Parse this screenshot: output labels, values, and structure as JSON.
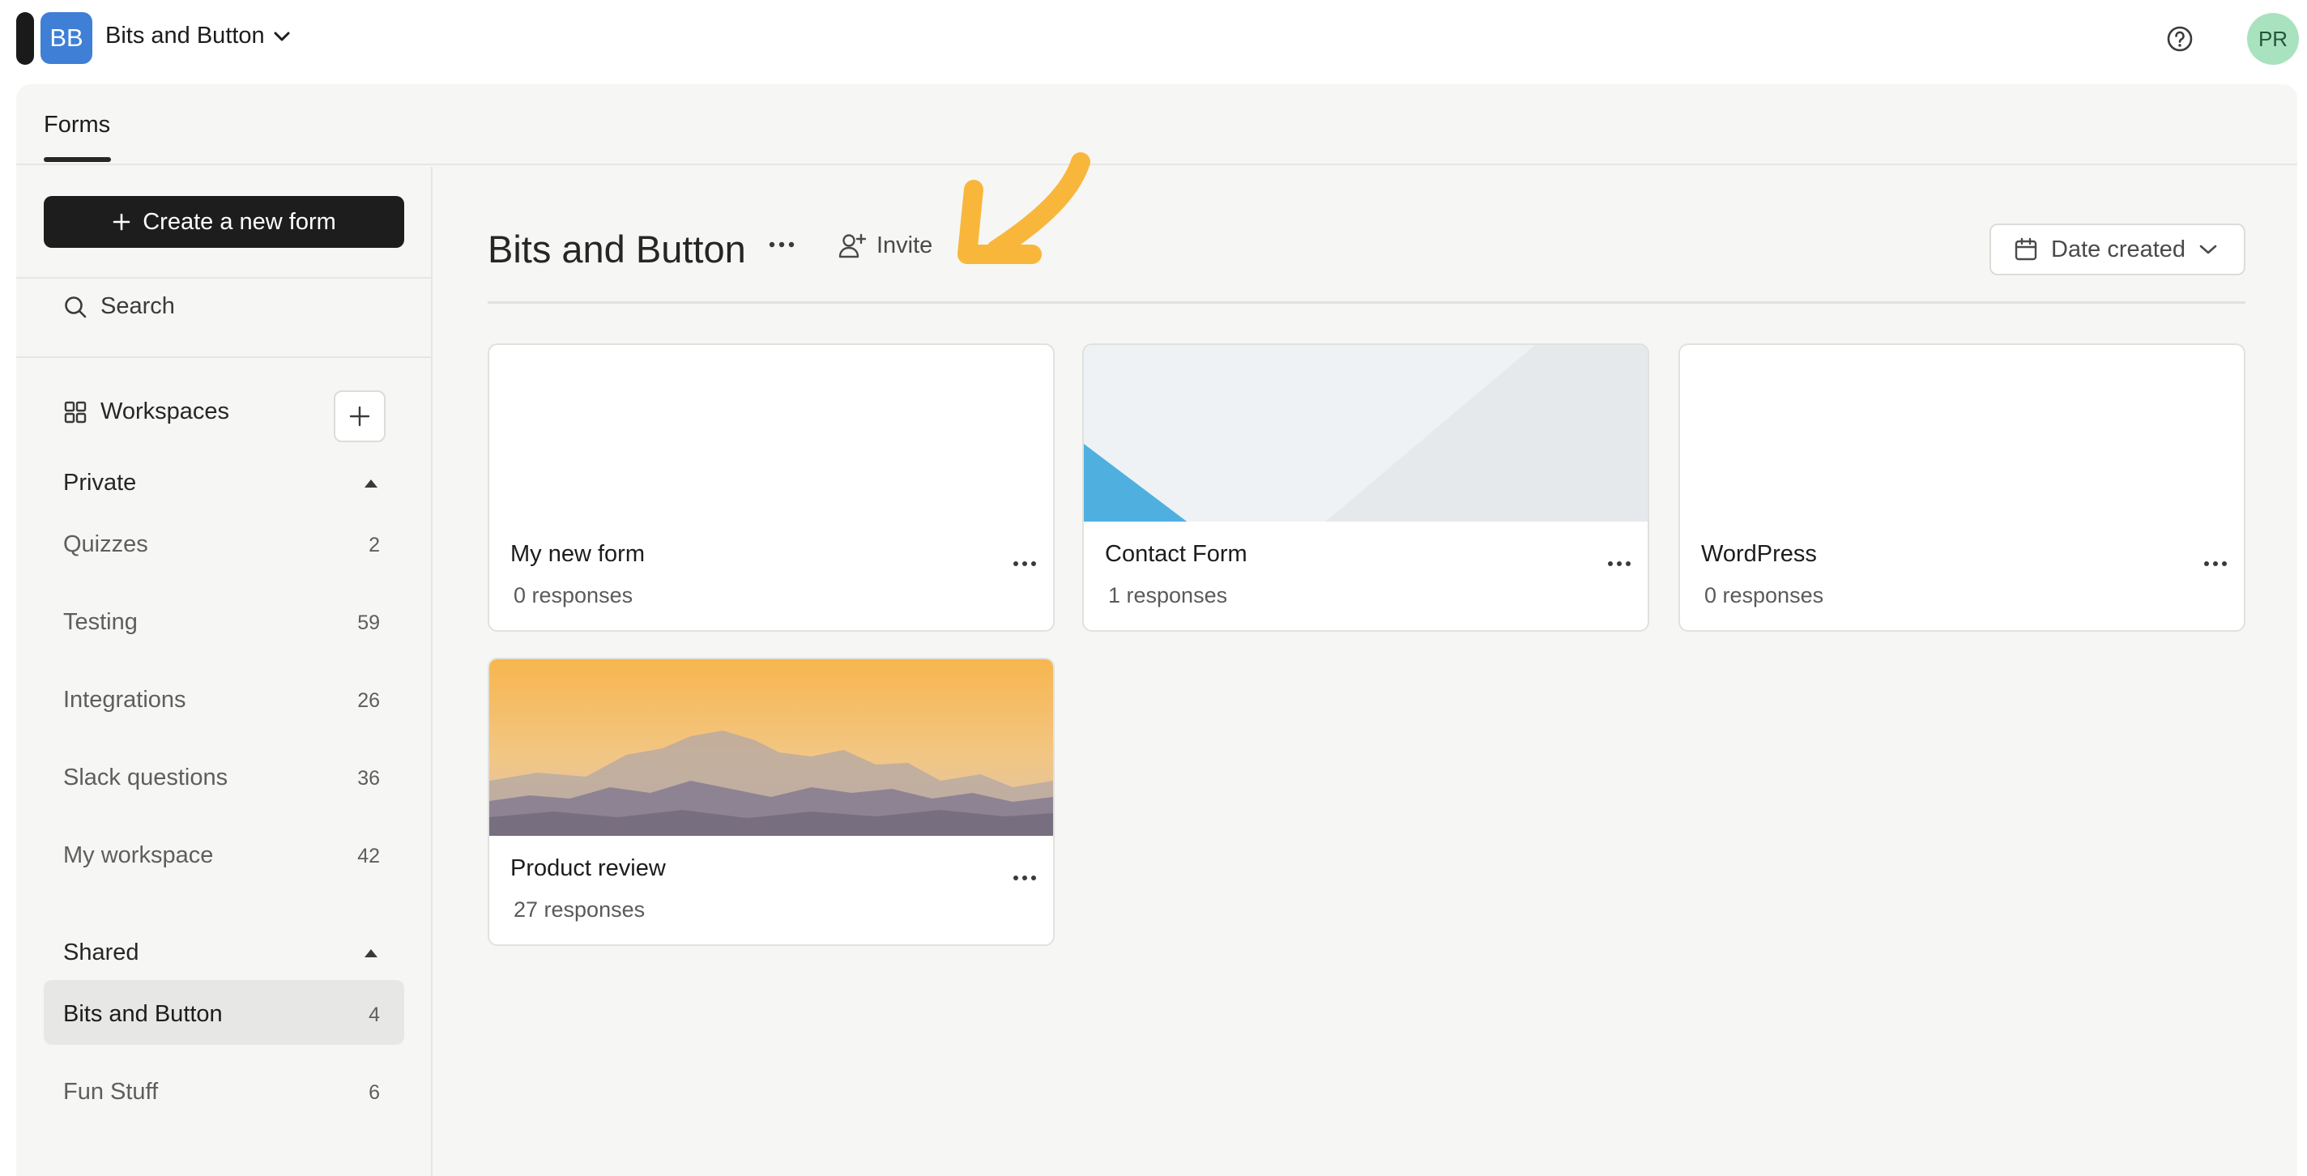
{
  "topbar": {
    "org_initials": "BB",
    "org_name": "Bits and Button",
    "help_icon": "question-circle-icon",
    "user_initials": "PR",
    "colors": {
      "org_badge": "#3f7fd6",
      "avatar_bg": "#a9e2bf"
    }
  },
  "tabs": [
    {
      "label": "Forms",
      "active": true
    }
  ],
  "sidebar": {
    "create_label": "Create a new form",
    "search_label": "Search",
    "workspaces_label": "Workspaces",
    "private_label": "Private",
    "shared_label": "Shared",
    "private_items": [
      {
        "name": "Quizzes",
        "count": "2"
      },
      {
        "name": "Testing",
        "count": "59"
      },
      {
        "name": "Integrations",
        "count": "26"
      },
      {
        "name": "Slack questions",
        "count": "36"
      },
      {
        "name": "My workspace",
        "count": "42"
      }
    ],
    "shared_items": [
      {
        "name": "Bits and Button",
        "count": "4",
        "active": true
      },
      {
        "name": "Fun Stuff",
        "count": "6"
      }
    ]
  },
  "main": {
    "workspace_title": "Bits and Button",
    "invite_label": "Invite",
    "sort_label": "Date created",
    "annotation_color": "#f8b73b",
    "forms": [
      {
        "name": "My new form",
        "responses": "0 responses",
        "thumbnail": "blank"
      },
      {
        "name": "Contact Form",
        "responses": "1 responses",
        "thumbnail": "geometric"
      },
      {
        "name": "WordPress",
        "responses": "0 responses",
        "thumbnail": "blank"
      },
      {
        "name": "Product review",
        "responses": "27 responses",
        "thumbnail": "mountain-sunset"
      }
    ]
  }
}
